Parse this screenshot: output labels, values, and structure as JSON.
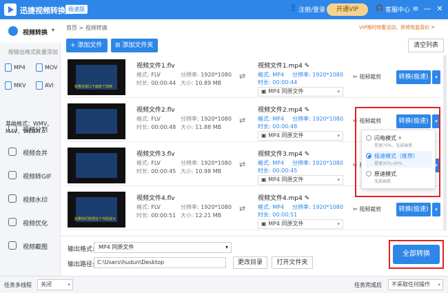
{
  "app": {
    "title": "迅捷视频转换器",
    "edition_badge": "极速版",
    "login": "注册/登录",
    "vip": "开通VIP",
    "help": "客服中心",
    "win_menu": "≡",
    "win_min": "—",
    "win_close": "✕"
  },
  "sidebar": {
    "current": "视频转换",
    "chevron": "▾",
    "sub_label": "按输出格式批量添加",
    "formats": [
      "MP4",
      "MOV",
      "MKV",
      "AVI"
    ],
    "other_formats": [
      "其他格式：WMV、",
      "M4V、WEBM..."
    ],
    "items": [
      "视频分割",
      "视频合并",
      "视频转GIF",
      "视频水印",
      "视频优化",
      "视频截图"
    ]
  },
  "breadcrumb": "首页 > 视频转换",
  "promo": "VIP限时特惠活动，即将恢复原价 ✕",
  "toolbar": {
    "add_file": "+ 添加文件",
    "add_folder": "⊞ 添加文件夹",
    "clear_list": "清空列表"
  },
  "labels": {
    "format": "格式:",
    "resolution": "分辨率:",
    "duration": "时长:",
    "size": "大小:",
    "trim": "✂ 视频裁剪",
    "convert": "转换(极速)",
    "out_format_option": "MP4  同原文件"
  },
  "files": [
    {
      "name": "视频文件1.flv",
      "format": "FLV",
      "resolution": "1920*1080",
      "duration": "00:00:44",
      "size": "10.89 MB",
      "out_name": "视频文件1.mp4",
      "out_format": "MP4",
      "out_resolution": "1920*1080",
      "out_duration": "00:00:44",
      "subtitle": "就像在窗口下面有个剪映"
    },
    {
      "name": "视频文件2.flv",
      "format": "FLV",
      "resolution": "1920*1080",
      "duration": "00:00:48",
      "size": "11.88 MB",
      "out_name": "视频文件2.mp4",
      "out_format": "MP4",
      "out_resolution": "1920*1080",
      "out_duration": "00:00:48",
      "subtitle": ""
    },
    {
      "name": "视频文件3.flv",
      "format": "FLV",
      "resolution": "1920*1080",
      "duration": "00:00:45",
      "size": "10.98 MB",
      "out_name": "视频文件3.mp4",
      "out_format": "MP4",
      "out_resolution": "1920*1080",
      "out_duration": "00:00:45",
      "subtitle": ""
    },
    {
      "name": "视频文件4.flv",
      "format": "FLV",
      "resolution": "1920*1080",
      "duration": "00:00:51",
      "size": "12.21 MB",
      "out_name": "视频文件4.mp4",
      "out_format": "MP4",
      "out_resolution": "1920*1080",
      "out_duration": "00:00:51",
      "subtitle": "如果你们想把这个代码放大"
    }
  ],
  "popup": {
    "options": [
      {
        "title": "闪电模式 ⚡",
        "sub": "提速70%，无损画质"
      },
      {
        "title": "极速模式（推荐）",
        "sub": "提速30%-40%"
      },
      {
        "title": "原速模式",
        "sub": "无损画质"
      }
    ]
  },
  "bottom": {
    "output_format_label": "输出格式:",
    "output_format_value": "MP4  同原文件",
    "output_path_label": "输出路径:",
    "output_path_value": "C:\\Users\\hudun\\Desktop",
    "change_dir": "更改目录",
    "open_folder": "打开文件夹",
    "convert_all": "全部转换"
  },
  "statusbar": {
    "multithread_label": "任务多线程",
    "multithread_value": "关闭",
    "after_done_label": "任务完成后",
    "after_done_value": "不采取任何操作",
    "dropdown": "▾"
  },
  "colors": {
    "accent": "#2e86e8",
    "highlight_box": "#e02020",
    "promo": "#e07020"
  }
}
